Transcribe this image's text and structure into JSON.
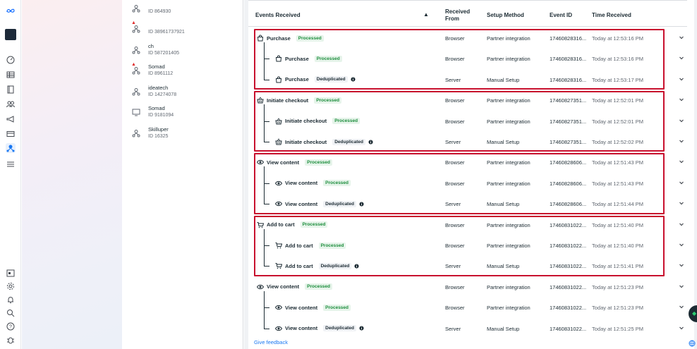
{
  "sidebar_icons": [
    "meta-logo",
    "brand-avatar",
    "dashboard-icon",
    "table-icon",
    "book-icon",
    "people-icon",
    "megaphone-icon",
    "card-icon",
    "events-manager-icon",
    "menu-icon",
    "calendar-icon",
    "settings-icon",
    "bell-icon",
    "search-icon",
    "help-icon",
    "bug-icon"
  ],
  "datasets": [
    {
      "name": "",
      "id": "ID 864930"
    },
    {
      "name": "",
      "id": "ID 38961737921",
      "warning": true
    },
    {
      "name": "ch",
      "id": "ID 587201405"
    },
    {
      "name": "Somad",
      "id": "ID 8961112",
      "warning": true
    },
    {
      "name": "ideatech",
      "id": "ID 14274078"
    },
    {
      "name": "Somad",
      "id": "ID 9181094"
    },
    {
      "name": "Skilluper",
      "id": "ID 16325"
    }
  ],
  "table": {
    "headers": {
      "events": "Events Received",
      "from_line1": "Received",
      "from_line2": "From",
      "method": "Setup Method",
      "event_id": "Event ID",
      "time": "Time Received"
    },
    "groups": [
      {
        "icon": "shopping-bag-icon",
        "boxed": true,
        "rows": [
          {
            "name": "Purchase",
            "status": "Processed",
            "from": "Browser",
            "method": "Partner integration",
            "event_id": "17460828316...",
            "time": "Today at 12:53:16 PM",
            "child": false
          },
          {
            "name": "Purchase",
            "status": "Processed",
            "from": "Browser",
            "method": "Partner integration",
            "event_id": "17460828316...",
            "time": "Today at 12:53:16 PM",
            "child": true
          },
          {
            "name": "Purchase",
            "status": "Deduplicated",
            "from": "Server",
            "method": "Manual Setup",
            "event_id": "17460828316...",
            "time": "Today at 12:53:17 PM",
            "child": true
          }
        ]
      },
      {
        "icon": "basket-icon",
        "boxed": true,
        "rows": [
          {
            "name": "Initiate checkout",
            "status": "Processed",
            "from": "Browser",
            "method": "Partner integration",
            "event_id": "17460827351...",
            "time": "Today at 12:52:01 PM",
            "child": false
          },
          {
            "name": "Initiate checkout",
            "status": "Processed",
            "from": "Browser",
            "method": "Partner integration",
            "event_id": "17460827351...",
            "time": "Today at 12:52:01 PM",
            "child": true
          },
          {
            "name": "Initiate checkout",
            "status": "Deduplicated",
            "from": "Server",
            "method": "Manual Setup",
            "event_id": "17460827351...",
            "time": "Today at 12:52:02 PM",
            "child": true
          }
        ]
      },
      {
        "icon": "eye-icon",
        "boxed": true,
        "rows": [
          {
            "name": "View content",
            "status": "Processed",
            "from": "Browser",
            "method": "Partner integration",
            "event_id": "17460828606...",
            "time": "Today at 12:51:43 PM",
            "child": false
          },
          {
            "name": "View content",
            "status": "Processed",
            "from": "Browser",
            "method": "Partner integration",
            "event_id": "17460828606...",
            "time": "Today at 12:51:43 PM",
            "child": true
          },
          {
            "name": "View content",
            "status": "Deduplicated",
            "from": "Server",
            "method": "Manual Setup",
            "event_id": "17460828606...",
            "time": "Today at 12:51:44 PM",
            "child": true
          }
        ]
      },
      {
        "icon": "cart-icon",
        "boxed": true,
        "rows": [
          {
            "name": "Add to cart",
            "status": "Processed",
            "from": "Browser",
            "method": "Partner integration",
            "event_id": "17460831022...",
            "time": "Today at 12:51:40 PM",
            "child": false
          },
          {
            "name": "Add to cart",
            "status": "Processed",
            "from": "Browser",
            "method": "Partner integration",
            "event_id": "17460831022...",
            "time": "Today at 12:51:40 PM",
            "child": true
          },
          {
            "name": "Add to cart",
            "status": "Deduplicated",
            "from": "Server",
            "method": "Manual Setup",
            "event_id": "17460831022...",
            "time": "Today at 12:51:41 PM",
            "child": true
          }
        ]
      },
      {
        "icon": "eye-icon",
        "boxed": false,
        "rows": [
          {
            "name": "View content",
            "status": "Processed",
            "from": "Browser",
            "method": "Partner integration",
            "event_id": "17460831022...",
            "time": "Today at 12:51:23 PM",
            "child": false
          },
          {
            "name": "View content",
            "status": "Processed",
            "from": "Browser",
            "method": "Partner integration",
            "event_id": "17460831022...",
            "time": "Today at 12:51:23 PM",
            "child": true
          },
          {
            "name": "View content",
            "status": "Deduplicated",
            "from": "Server",
            "method": "Manual Setup",
            "event_id": "17460831022...",
            "time": "Today at 12:51:25 PM",
            "child": true
          }
        ]
      }
    ]
  },
  "footer": {
    "feedback": "Give feedback"
  },
  "colors": {
    "highlight_box": "#c8102e",
    "processed": "#1e8e3e",
    "link": "#1877f2"
  }
}
